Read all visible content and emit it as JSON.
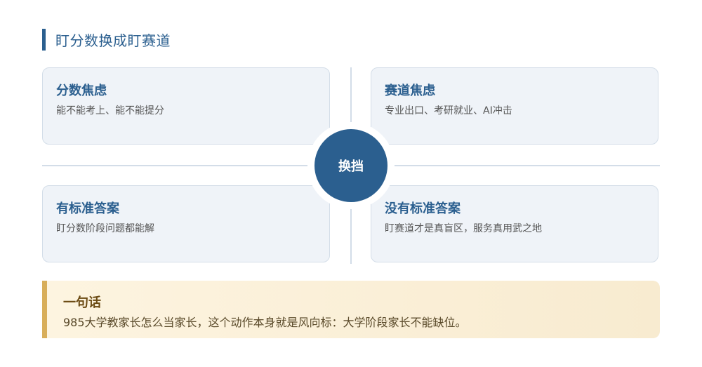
{
  "title": "盯分数换成盯赛道",
  "hub": {
    "label": "换挡"
  },
  "cards": {
    "top_left": {
      "heading": "分数焦虑",
      "desc": "能不能考上、能不能提分"
    },
    "top_right": {
      "heading": "赛道焦虑",
      "desc": "专业出口、考研就业、AI冲击"
    },
    "bottom_left": {
      "heading": "有标准答案",
      "desc": "盯分数阶段问题都能解"
    },
    "bottom_right": {
      "heading": "没有标准答案",
      "desc": "盯赛道才是真盲区，服务真用武之地"
    }
  },
  "summary": {
    "heading": "一句话",
    "text": "985大学教家长怎么当家长，这个动作本身就是风向标：大学阶段家长不能缺位。"
  },
  "colors": {
    "accent": "#2b5f8f",
    "card_bg": "#eff3f8",
    "summary_bar": "#d8ae5a"
  }
}
